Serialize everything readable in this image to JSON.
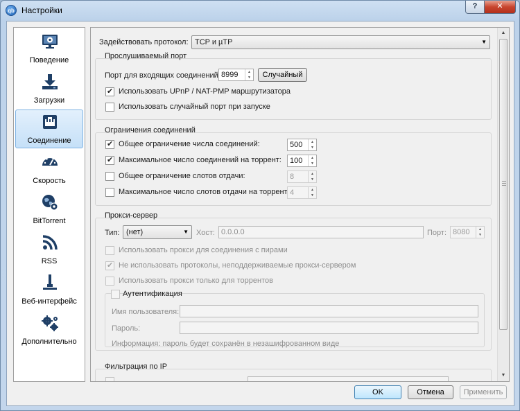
{
  "window": {
    "title": "Настройки",
    "help": "?",
    "close": "✕",
    "app_icon_text": "qb"
  },
  "sidebar": {
    "items": [
      {
        "label": "Поведение",
        "icon": "monitor-gear-icon"
      },
      {
        "label": "Загрузки",
        "icon": "download-icon"
      },
      {
        "label": "Соединение",
        "icon": "network-icon"
      },
      {
        "label": "Скорость",
        "icon": "speedometer-icon"
      },
      {
        "label": "BitTorrent",
        "icon": "globe-gear-icon"
      },
      {
        "label": "RSS",
        "icon": "rss-icon"
      },
      {
        "label": "Веб-интерфейс",
        "icon": "web-ui-icon"
      },
      {
        "label": "Дополнительно",
        "icon": "gears-icon"
      }
    ],
    "selected_index": 2
  },
  "protocol": {
    "label": "Задействовать протокол:",
    "value": "TCP и µTP"
  },
  "listening_port": {
    "title": "Прослушиваемый порт",
    "port_label": "Порт для входящих соединений:",
    "port_value": "8999",
    "random_button": "Случайный",
    "upnp_label": "Использовать UPnP / NAT-PMP маршрутизатора",
    "upnp_checked": true,
    "random_on_start_label": "Использовать случайный порт при запуске",
    "random_on_start_checked": false
  },
  "connection_limits": {
    "title": "Ограничения соединений",
    "global_connections": {
      "label": "Общее ограничение числа соединений:",
      "value": "500",
      "checked": true
    },
    "per_torrent_connections": {
      "label": "Максимальное число соединений на торрент:",
      "value": "100",
      "checked": true
    },
    "global_upload_slots": {
      "label": "Общее ограничение слотов отдачи:",
      "value": "8",
      "checked": false
    },
    "per_torrent_upload_slots": {
      "label": "Максимальное число слотов отдачи на торрент:",
      "value": "4",
      "checked": false
    }
  },
  "proxy": {
    "title": "Прокси-сервер",
    "type_label": "Тип:",
    "type_value": "(нет)",
    "host_label": "Хост:",
    "host_value": "0.0.0.0",
    "port_label": "Порт:",
    "port_value": "8080",
    "peer_connections_label": "Использовать прокси для соединения с пирами",
    "peer_connections_checked": false,
    "disable_unsupported_label": "Не использовать протоколы, неподдерживаемые прокси-сервером",
    "disable_unsupported_checked": true,
    "torrents_only_label": "Использовать прокси только для торрентов",
    "torrents_only_checked": false,
    "auth": {
      "title": "Аутентификация",
      "checked": false,
      "username_label": "Имя пользователя:",
      "password_label": "Пароль:",
      "info": "Информация: пароль будет сохранён в незашифрованном виде"
    }
  },
  "ip_filter": {
    "title": "Фильтрация по IP"
  },
  "buttons": {
    "ok": "OK",
    "cancel": "Отмена",
    "apply": "Применить"
  }
}
